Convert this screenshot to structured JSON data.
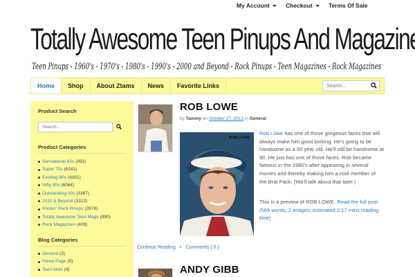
{
  "topnav": {
    "account": "My Account",
    "checkout": "Checkout",
    "terms": "Terms Of Sale"
  },
  "site": {
    "title": "Totally Awesome Teen Pinups And Magazines",
    "tagline": "Teen Pinups - 1960's - 1970's - 1980's - 1990's - 2000 and Beyond - Rock Pinups - Teen Magazines - Rock Magazines"
  },
  "mainnav": {
    "items": [
      {
        "label": "Home"
      },
      {
        "label": "Shop"
      },
      {
        "label": "About Ztams"
      },
      {
        "label": "News"
      },
      {
        "label": "Favorite Links"
      }
    ],
    "search_placeholder": "Search..."
  },
  "sidebar": {
    "product_search": {
      "heading": "Product Search",
      "placeholder": "Search..."
    },
    "product_categories": {
      "heading": "Product Categories",
      "items": [
        {
          "label": "Sensational 60s",
          "count": "(992)"
        },
        {
          "label": "Super 70s",
          "count": "(6341)"
        },
        {
          "label": "Exciting 80s",
          "count": "(6351)"
        },
        {
          "label": "Nifty 90s",
          "count": "(6064)"
        },
        {
          "label": "Outstanding 00s",
          "count": "(3387)"
        },
        {
          "label": "2010 & Beyond",
          "count": "(3313)"
        },
        {
          "label": "Rockin' Rock Pinups",
          "count": "(2878)"
        },
        {
          "label": "Totally Awesome Teen Mags",
          "count": "(890)"
        },
        {
          "label": "Rock Magazines",
          "count": "(409)"
        }
      ]
    },
    "blog_categories": {
      "heading": "Blog Categories",
      "items": [
        {
          "label": "General",
          "count": "(3)"
        },
        {
          "label": "Home Page",
          "count": "(5)"
        },
        {
          "label": "Teen Idols",
          "count": "(4)"
        }
      ]
    }
  },
  "posts": [
    {
      "title": "ROB LOWE",
      "by": "by",
      "author": "Tammy",
      "on": "on",
      "date": "October 27, 2013",
      "in": "in",
      "category": "General",
      "excerpt_link": "Rob Lowe",
      "excerpt": " has one of those gorgeous faces that will always make him good looking. He's going to be handsome as a 60 year old. He'll still be handsome at 90. He just has one of those faces. Rob became famous in the 1980's after appearing in several movies and thereby making him a cool member of the Brat Pack. (We'll talk about that later.)",
      "preview_prefix": "This is a preview of ROB LOWE. ",
      "preview_link": "Read the full post (569 words, 2 images, estimated 2:17 mins reading time)",
      "image_caption": "ROB LOWE",
      "continue": "Continue Reading",
      "comments": "Comments { 0 }"
    },
    {
      "title": "ANDY GIBB"
    }
  ],
  "colors": {
    "nav_bg": "#fdfa9c",
    "sidebar_bg": "#fdfa9c",
    "link": "#2a7dc1"
  }
}
